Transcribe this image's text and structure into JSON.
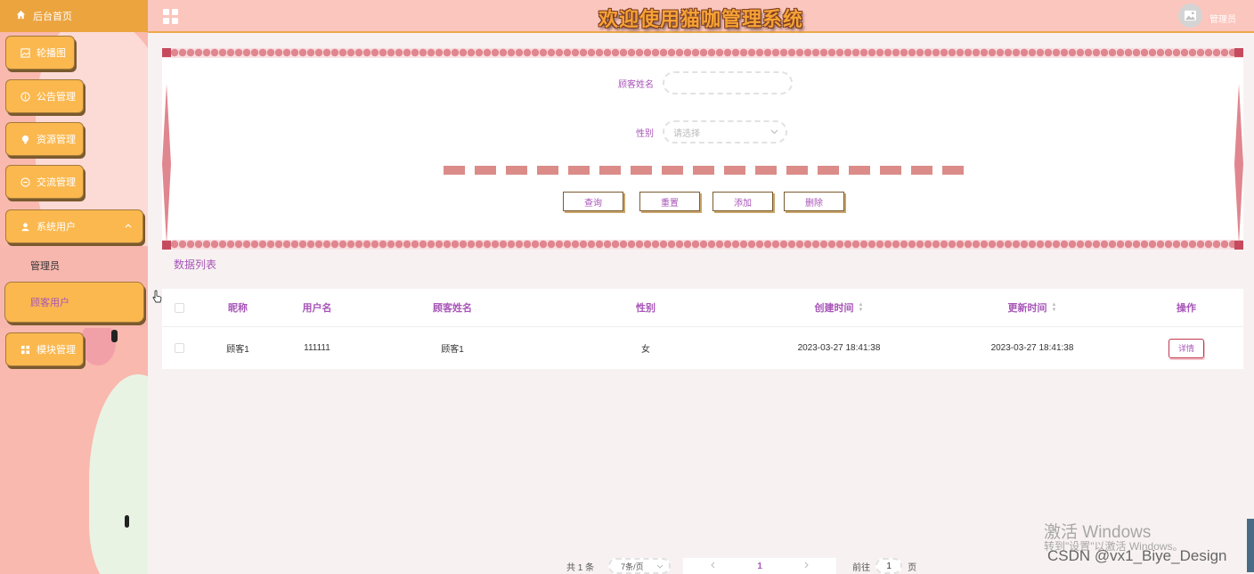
{
  "sidebar": {
    "home": "后台首页",
    "menu": [
      {
        "label": "轮播图"
      },
      {
        "label": "公告管理"
      },
      {
        "label": "资源管理"
      },
      {
        "label": "交流管理"
      },
      {
        "label": "系统用户"
      },
      {
        "label": "模块管理"
      }
    ],
    "submenu": [
      "管理员",
      "顾客用户"
    ]
  },
  "header": {
    "title": "欢迎使用猫咖管理系统",
    "user": "管理员"
  },
  "search": {
    "name_label": "顾客姓名",
    "gender_label": "性别",
    "gender_placeholder": "请选择",
    "buttons": {
      "query": "查询",
      "reset": "重置",
      "add": "添加",
      "delete": "删除"
    }
  },
  "list_title": "数据列表",
  "table": {
    "headers": [
      "昵称",
      "用户名",
      "顾客姓名",
      "性别",
      "创建时间",
      "更新时间",
      "操作"
    ],
    "rows": [
      {
        "nickname": "顾客1",
        "username": "111111",
        "name": "顾客1",
        "gender": "女",
        "created": "2023-03-27 18:41:38",
        "updated": "2023-03-27 18:41:38",
        "action": "详情"
      }
    ]
  },
  "pager": {
    "total": "共 1 条",
    "size": "7条/页",
    "current": "1",
    "goto_label": "前往",
    "goto_value": "1",
    "page_unit": "页"
  },
  "watermark": {
    "line1": "激活 Windows",
    "line2": "转到\"设置\"以激活 Windows。",
    "csdn": "CSDN @vx1_Biye_Design"
  },
  "colors": {
    "accent": "#a855b8",
    "header": "#fbc6bd",
    "menu": "#fbb84f"
  }
}
